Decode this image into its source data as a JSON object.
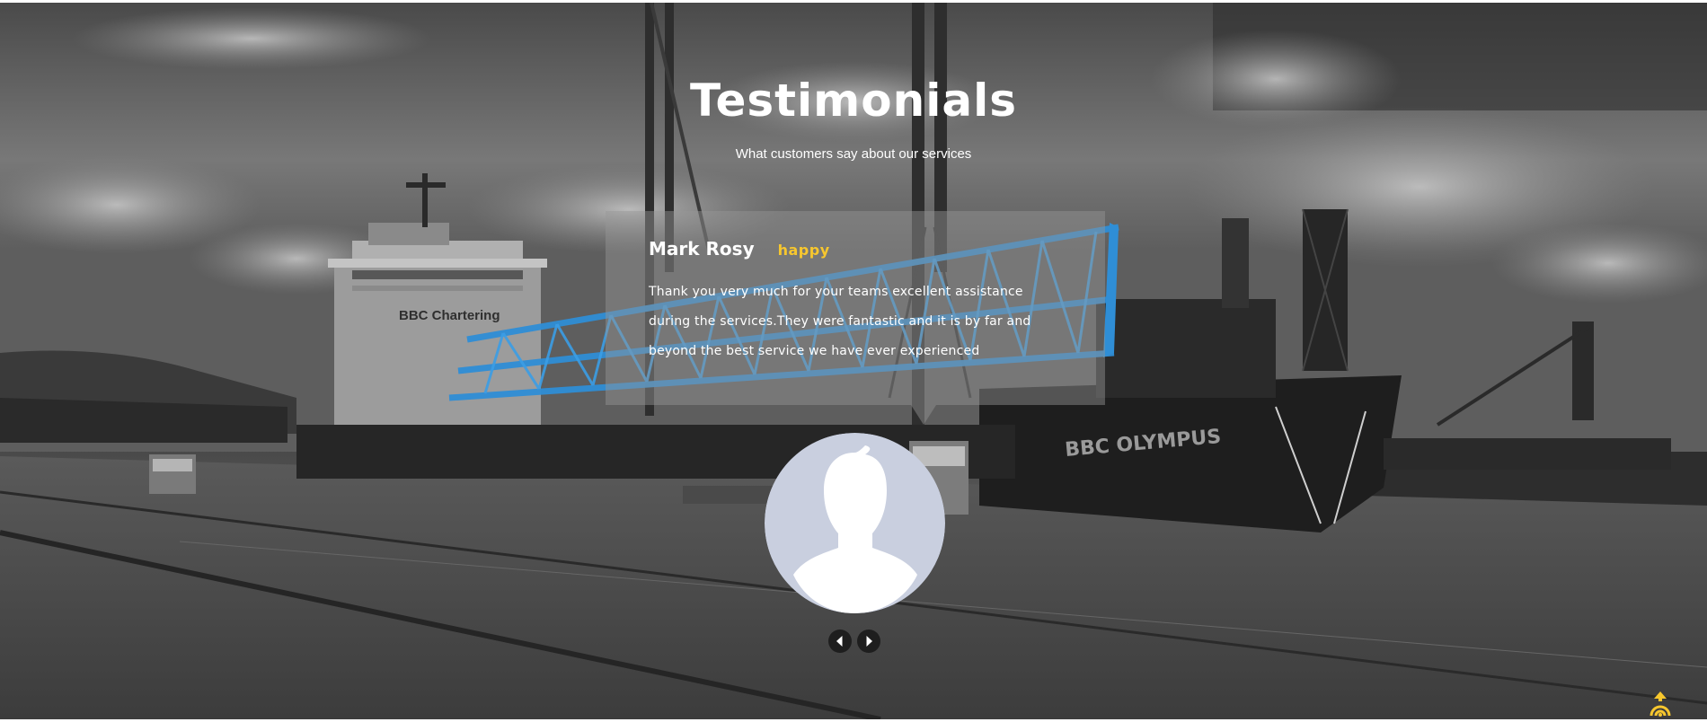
{
  "section": {
    "title": "Testimonials",
    "subtitle": "What customers say about our services"
  },
  "testimonial": {
    "author": "Mark Rosy",
    "rating": "happy",
    "quote": "Thank you very much for your teams excellent assistance during the services.They were fantastic and it is by far and beyond the best service we have ever experienced"
  },
  "background": {
    "ship_hull_text": "BBC OLYMPUS",
    "building_sign_text": "BBC Chartering"
  },
  "controls": {
    "prev_icon": "chevron-left-icon",
    "next_icon": "chevron-right-icon",
    "scroll_top_icon": "arrow-up-icon"
  },
  "colors": {
    "rating": "#f7c72e",
    "crane_blue": "#2f8ed6",
    "avatar_bg": "#c9cfdf",
    "scroll_top": "#f7c72e"
  }
}
